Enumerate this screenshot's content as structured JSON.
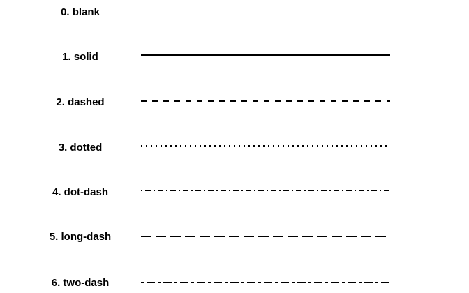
{
  "linetypes": [
    {
      "label": "0. blank",
      "pattern": "blank"
    },
    {
      "label": "1. solid",
      "pattern": "solid"
    },
    {
      "label": "2. dashed",
      "pattern": "dashed"
    },
    {
      "label": "3. dotted",
      "pattern": "dotted"
    },
    {
      "label": "4. dot-dash",
      "pattern": "dot-dash"
    },
    {
      "label": "5. long-dash",
      "pattern": "long-dash"
    },
    {
      "label": "6. two-dash",
      "pattern": "two-dash"
    }
  ],
  "colors": {
    "line": "#000000",
    "text": "#000000",
    "background": "#ffffff"
  }
}
